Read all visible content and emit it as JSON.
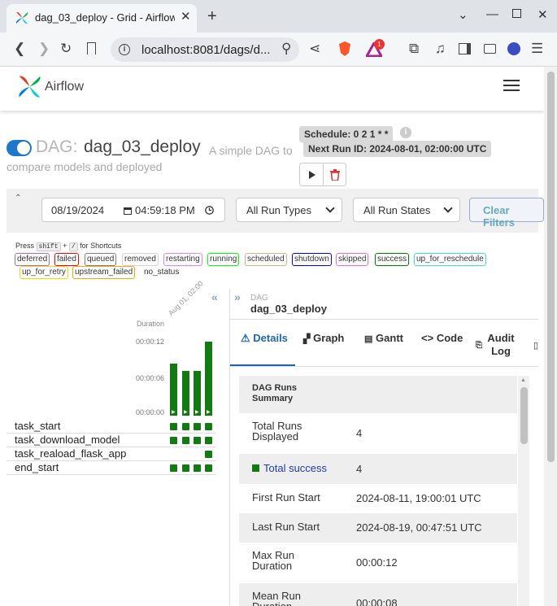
{
  "browser": {
    "tab_title": "dag_03_deploy - Grid - Airflow",
    "url": "localhost:8081/dags/d...",
    "brave_badge": "1"
  },
  "nav": {
    "logo_text": "Airflow"
  },
  "dag": {
    "prefix": "DAG:",
    "name": "dag_03_deploy",
    "description": "A simple DAG to compare models and deployed",
    "schedule": "Schedule: 0 2 1 * *",
    "next_run": "Next Run ID: 2024-08-01, 02:00:00 UTC"
  },
  "filters": {
    "date": "08/19/2024",
    "time": "04:59:18 PM",
    "run_types": "All Run Types",
    "run_states": "All Run States",
    "clear": "Clear Filters"
  },
  "legend": {
    "press": "Press",
    "shift": "shift",
    "plus": "+",
    "slash": "/",
    "for_shortcuts": "for Shortcuts",
    "states": [
      {
        "label": "deferred",
        "color": "#9370db"
      },
      {
        "label": "failed",
        "color": "#ff0000"
      },
      {
        "label": "queued",
        "color": "#808080"
      },
      {
        "label": "removed",
        "color": "#d3d3d3"
      },
      {
        "label": "restarting",
        "color": "#ee82ee"
      },
      {
        "label": "running",
        "color": "#00ff00"
      },
      {
        "label": "scheduled",
        "color": "#d2b48c"
      },
      {
        "label": "shutdown",
        "color": "#0000ff"
      },
      {
        "label": "skipped",
        "color": "#ff69b4"
      },
      {
        "label": "success",
        "color": "#008000"
      },
      {
        "label": "up_for_reschedule",
        "color": "#40e0d0"
      },
      {
        "label": "up_for_retry",
        "color": "#ffd700"
      },
      {
        "label": "upstream_failed",
        "color": "#ffa500"
      },
      {
        "label": "no_status",
        "color": "#ffffff"
      }
    ]
  },
  "grid": {
    "duration_label": "Duration",
    "run_label": "Aug 01, 02:00",
    "ticks": [
      "00:00:12",
      "00:00:06",
      "00:00:00"
    ],
    "run_durations": [
      0.7,
      0.6,
      0.6,
      1.0
    ],
    "tasks": [
      "task_start",
      "task_download_model",
      "task_reaload_flask_app",
      "end_start"
    ]
  },
  "details": {
    "dag_label": "DAG",
    "dag_name": "dag_03_deploy",
    "tabs": [
      "Details",
      "Graph",
      "Gantt",
      "Code",
      "Audit Log"
    ],
    "summary_header": "DAG Runs Summary",
    "rows": [
      {
        "k": "Total Runs Displayed",
        "v": "4"
      },
      {
        "k": "Total success",
        "v": "4"
      },
      {
        "k": "First Run Start",
        "v": "2024-08-11, 19:00:01 UTC"
      },
      {
        "k": "Last Run Start",
        "v": "2024-08-19, 00:47:51 UTC"
      },
      {
        "k": "Max Run Duration",
        "v": "00:00:12"
      },
      {
        "k": "Mean Run Duration",
        "v": "00:00:08"
      }
    ]
  }
}
